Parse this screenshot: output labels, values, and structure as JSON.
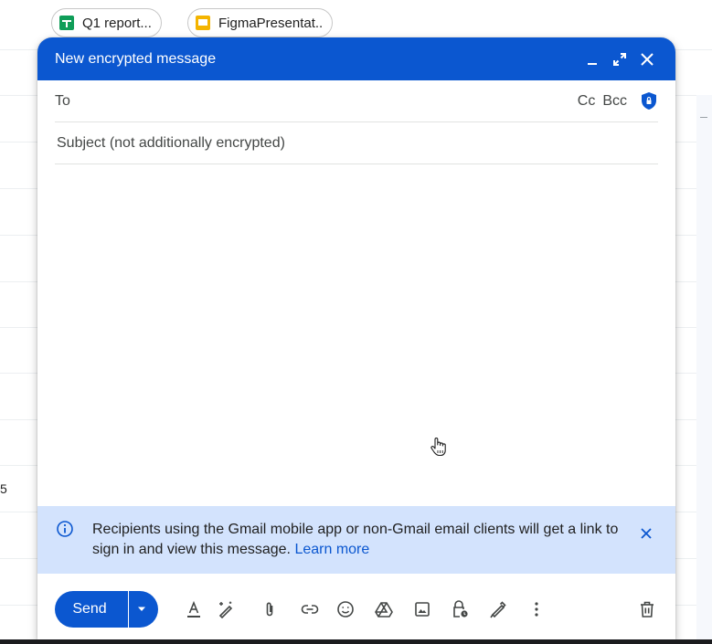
{
  "background": {
    "attachments": [
      {
        "name": "Q1 report...",
        "icon": "google-sheets-icon"
      },
      {
        "name": "FigmaPresentat..",
        "icon": "google-slides-icon"
      }
    ],
    "partial_value": "5"
  },
  "compose": {
    "title": "New encrypted message",
    "header_buttons": [
      "minimize-icon",
      "expand-icon",
      "close-icon"
    ],
    "to_label": "To",
    "cc_label": "Cc",
    "bcc_label": "Bcc",
    "subject_placeholder": "Subject (not additionally encrypted)",
    "subject_value": "",
    "body_value": ""
  },
  "banner": {
    "text": "Recipients using the Gmail mobile app or non-Gmail email clients will get a link to sign in and view this message.",
    "link": "Learn more"
  },
  "toolbar": {
    "send_label": "Send",
    "tools": [
      "format-text-icon",
      "ai-write-icon",
      "attach-icon",
      "insert-link-icon",
      "emoji-icon",
      "google-drive-icon",
      "insert-photo-icon",
      "confidential-mode-icon",
      "signature-icon",
      "more-options-icon",
      "discard-icon"
    ]
  },
  "colors": {
    "header_blue": "#0b57d0",
    "banner_blue": "#d3e3fd",
    "link_blue": "#0b57d0"
  }
}
